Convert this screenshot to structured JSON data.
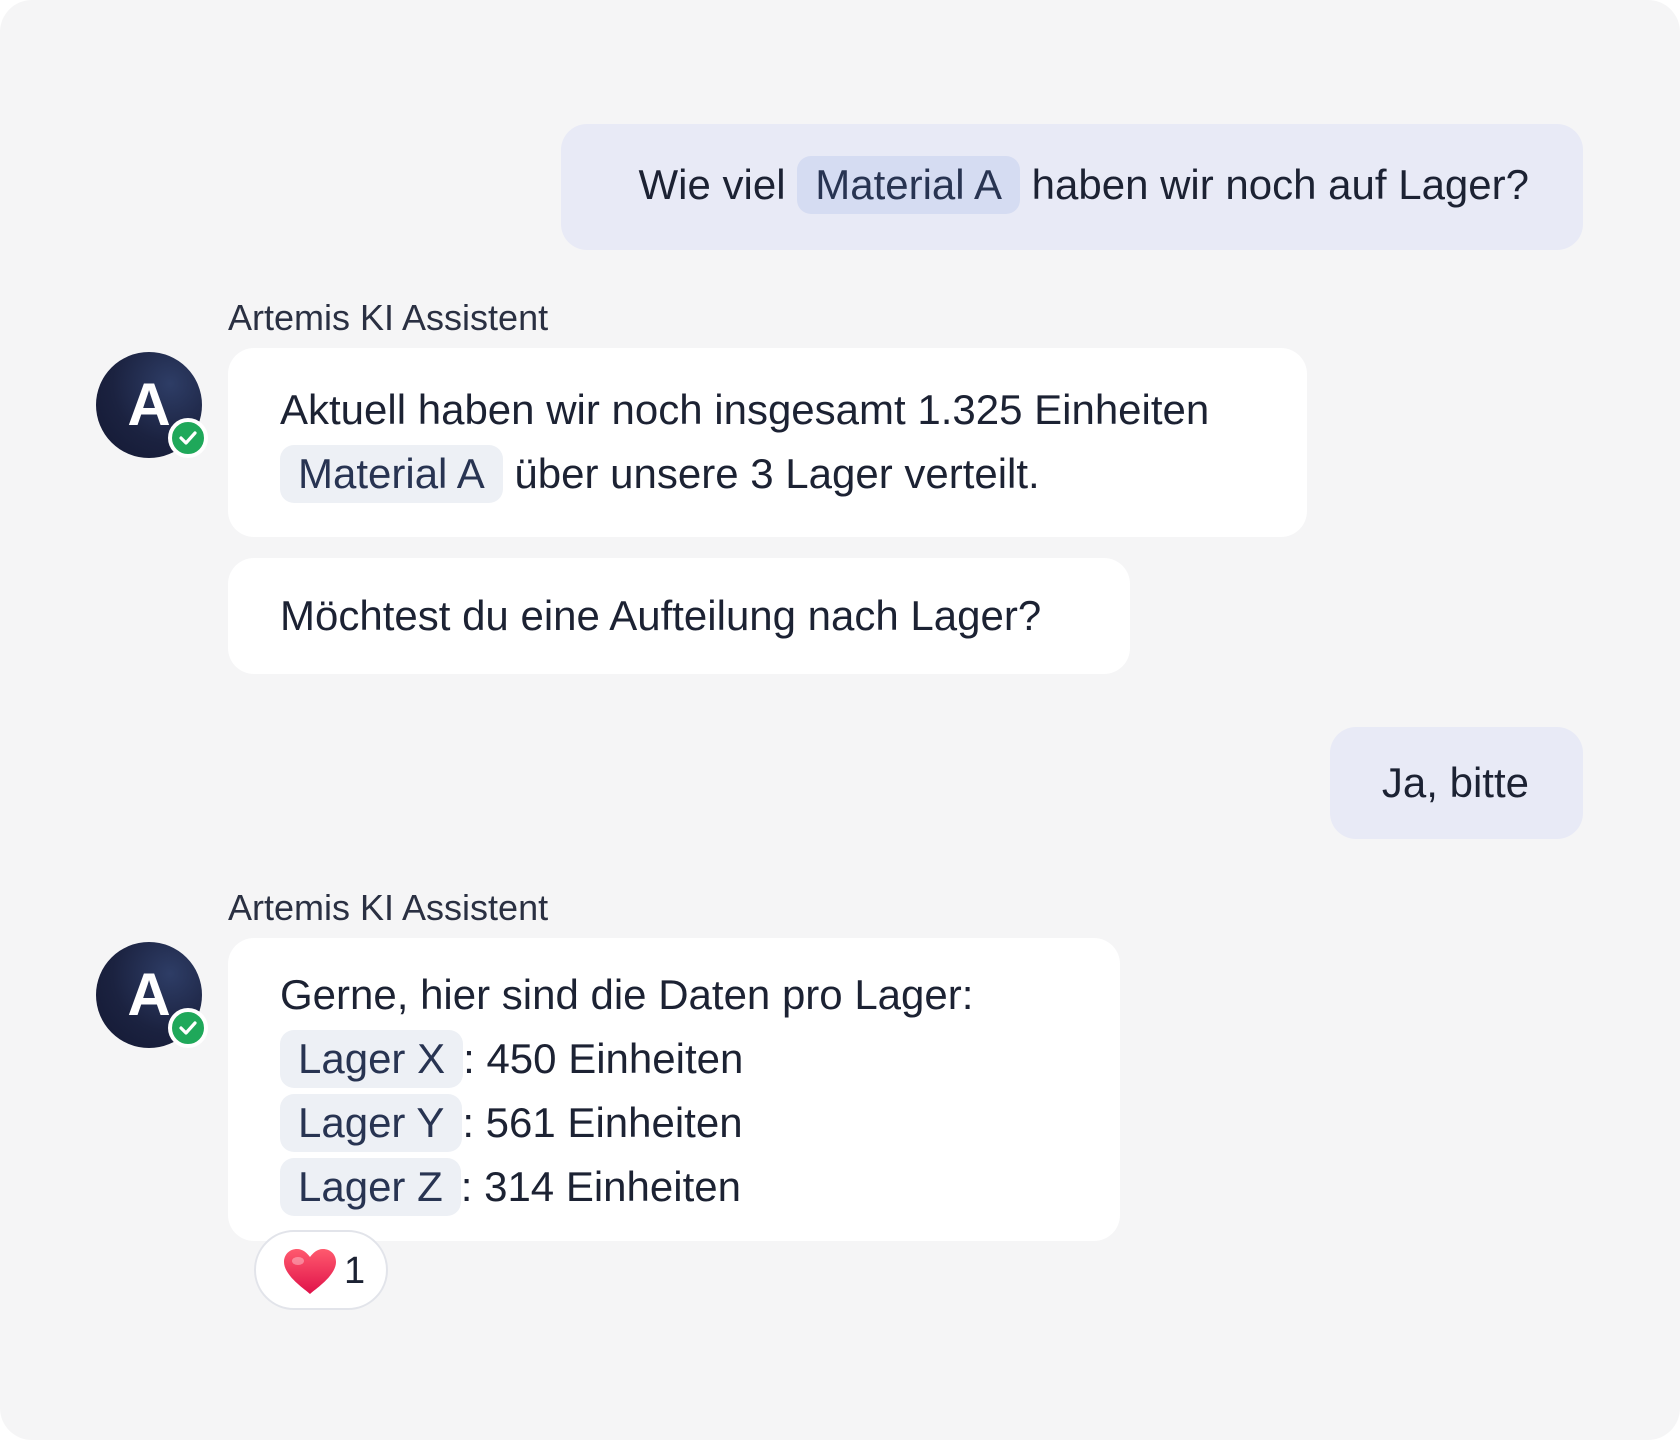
{
  "messages": {
    "user1": {
      "before": "Wie viel",
      "chip": "Material A",
      "after": "haben wir noch auf Lager?"
    },
    "bot1": {
      "sender": "Artemis KI Assistent",
      "avatar_letter": "A",
      "line1": "Aktuell haben wir noch insgesamt 1.325 Einheiten",
      "chip": "Material A",
      "line2_after": "über unsere 3 Lager verteilt.",
      "followup": "Möchtest du eine Aufteilung nach Lager?"
    },
    "user2": {
      "text": "Ja, bitte"
    },
    "bot2": {
      "sender": "Artemis KI Assistent",
      "avatar_letter": "A",
      "intro": "Gerne, hier sind die Daten pro Lager:",
      "rows": [
        {
          "chip": "Lager X",
          "value": ": 450 Einheiten"
        },
        {
          "chip": "Lager Y",
          "value": ": 561 Einheiten"
        },
        {
          "chip": "Lager Z",
          "value": ": 314 Einheiten"
        }
      ],
      "reaction": {
        "icon": "heart-icon",
        "count": "1"
      }
    }
  },
  "colors": {
    "background": "#f5f5f6",
    "user_bubble": "#e8eaf6",
    "bot_bubble": "#ffffff",
    "avatar": "#1b2240",
    "verified_badge": "#1fa85a",
    "heart": "#f0304e"
  }
}
